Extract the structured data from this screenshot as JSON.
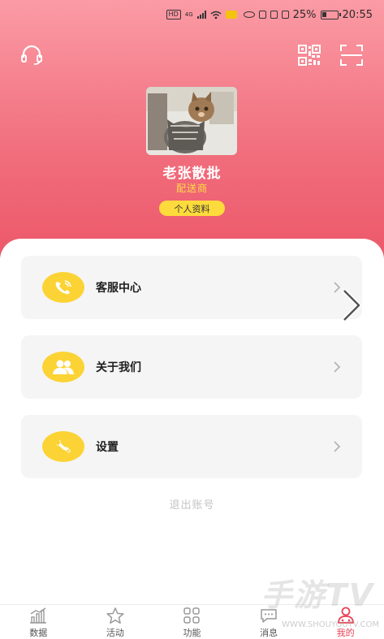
{
  "status_bar": {
    "battery": "25%",
    "time": "20:55",
    "network": "4G",
    "hd": "HD"
  },
  "top_bar": {
    "left_icon": "headset-icon",
    "right_icons": [
      "qr-code-icon",
      "scan-icon"
    ]
  },
  "profile": {
    "name": "老张散批",
    "role": "配送商",
    "profile_button": "个人资料"
  },
  "menu": {
    "items": [
      {
        "label": "客服中心",
        "icon": "phone-icon"
      },
      {
        "label": "关于我们",
        "icon": "users-icon"
      },
      {
        "label": "设置",
        "icon": "wrench-icon"
      }
    ],
    "logout": "退出账号"
  },
  "tabs": [
    {
      "label": "数据",
      "icon": "chart-icon",
      "active": false
    },
    {
      "label": "活动",
      "icon": "star-icon",
      "active": false
    },
    {
      "label": "功能",
      "icon": "grid-icon",
      "active": false
    },
    {
      "label": "消息",
      "icon": "message-icon",
      "active": false
    },
    {
      "label": "我的",
      "icon": "profile-icon",
      "active": true
    }
  ],
  "watermark": {
    "main": "手游TV",
    "sub": "WWW.SHOUYOUTV.COM"
  },
  "colors": {
    "header_top": "#fb9ba5",
    "header_bottom": "#ec5668",
    "accent_yellow": "#fcd335",
    "active_tab": "#e94256"
  }
}
